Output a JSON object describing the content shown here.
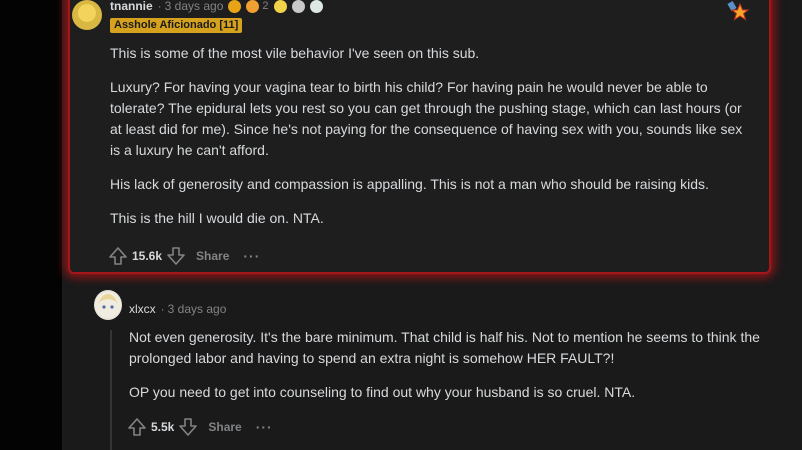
{
  "comment1": {
    "username": "tnannie",
    "time": "3 days ago",
    "award_count": "2",
    "flair": "Asshole Aficionado [11]",
    "paragraphs": [
      "This is some of the most vile behavior I've seen on this sub.",
      "Luxury? For having your vagina tear to birth his child? For having pain he would never be able to tolerate? The epidural lets you rest so you can get through the pushing stage, which can last hours (or at least did for me). Since he's not paying for the consequence of having sex with you, sounds like sex is a luxury he can't afford.",
      "His lack of generosity and compassion is appalling. This is not a man who should be raising kids.",
      "This is the hill I would die on. NTA."
    ],
    "score": "15.6k",
    "share_label": "Share",
    "more_label": "···"
  },
  "comment2": {
    "username": "xlxcx",
    "time": "3 days ago",
    "paragraphs": [
      "Not even generosity. It's the bare minimum. That child is half his. Not to mention he seems to think the prolonged labor and having to spend an extra night is somehow HER FAULT?!",
      "OP you need to get into counseling to find out why your husband is so cruel. NTA."
    ],
    "score": "5.5k",
    "share_label": "Share",
    "more_label": "···"
  },
  "colors": {
    "highlight_border": "#a4161a",
    "flair_bg": "#d6a21e",
    "text": "#d7dadc",
    "muted": "#818384"
  }
}
